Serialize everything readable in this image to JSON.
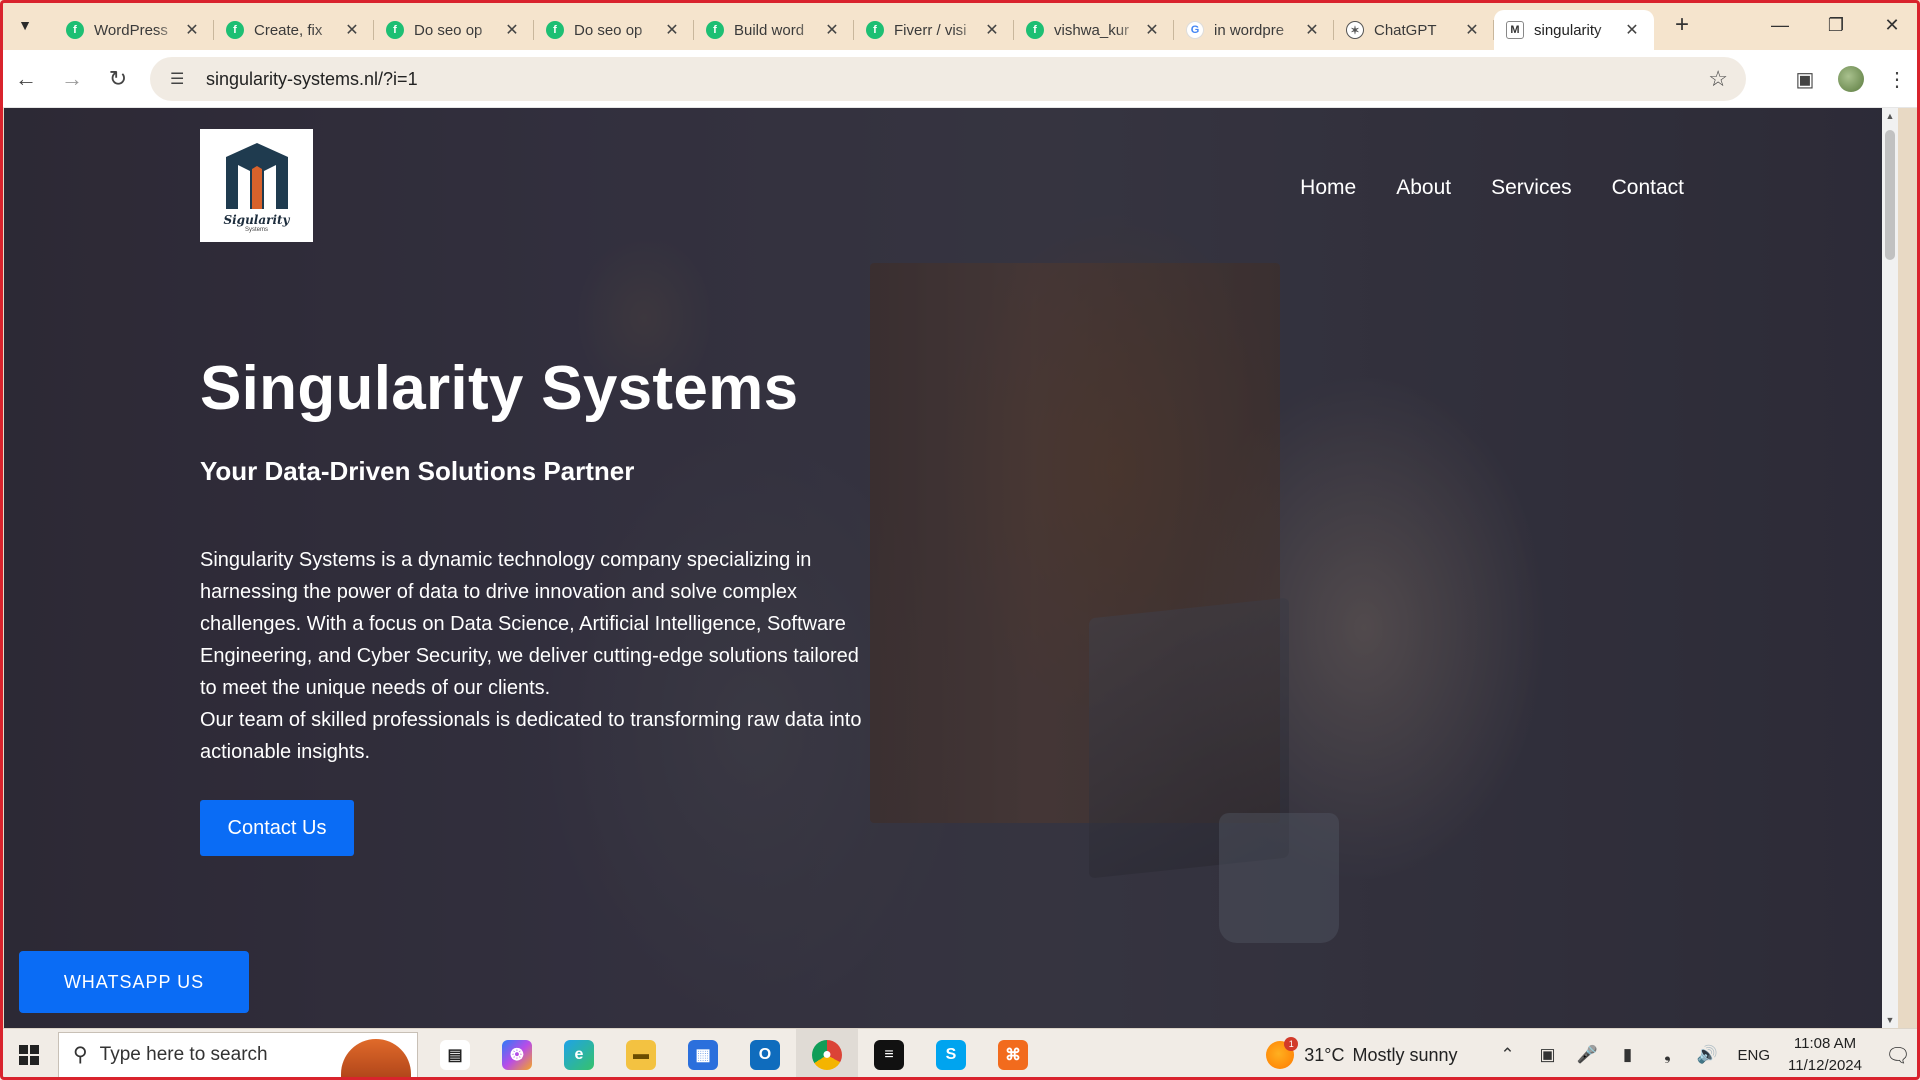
{
  "browser": {
    "tabs": [
      {
        "title": "WordPress",
        "favicon": "fiverr"
      },
      {
        "title": "Create, fix",
        "favicon": "fiverr"
      },
      {
        "title": "Do seo op",
        "favicon": "fiverr"
      },
      {
        "title": "Do seo op",
        "favicon": "fiverr"
      },
      {
        "title": "Build word",
        "favicon": "fiverr"
      },
      {
        "title": "Fiverr / visi",
        "favicon": "fiverr"
      },
      {
        "title": "vishwa_kur",
        "favicon": "fiverr"
      },
      {
        "title": "in wordpre",
        "favicon": "google"
      },
      {
        "title": "ChatGPT",
        "favicon": "chatgpt"
      },
      {
        "title": "singularity",
        "favicon": "site",
        "active": true
      }
    ],
    "url": "singularity-systems.nl/?i=1"
  },
  "site": {
    "logo_text": "Sigularity",
    "logo_sub": "Systems",
    "nav": [
      "Home",
      "About",
      "Services",
      "Contact"
    ],
    "hero": {
      "title": "Singularity Systems",
      "subtitle": "Your Data-Driven Solutions Partner",
      "paragraph1": "Singularity Systems is a dynamic technology company specializing in harnessing the power of data to drive innovation and solve complex challenges. With a focus on Data Science, Artificial Intelligence, Software Engineering, and Cyber Security, we deliver cutting-edge solutions tailored to meet the unique needs of our clients.",
      "paragraph2": "Our team of skilled professionals is dedicated to transforming raw data into actionable insights.",
      "cta_label": "Contact Us"
    },
    "whatsapp_label": "WHATSAPP US",
    "accent_color": "#0a6cf5"
  },
  "taskbar": {
    "search_placeholder": "Type here to search",
    "weather_badge": "1",
    "weather_temp": "31°C",
    "weather_condition": "Mostly sunny",
    "language": "ENG",
    "time": "11:08 AM",
    "date": "11/12/2024",
    "apps": [
      "task-view",
      "copilot",
      "edge",
      "file-explorer",
      "microsoft-store",
      "outlook",
      "chrome",
      "capcut",
      "skype",
      "xampp"
    ]
  }
}
